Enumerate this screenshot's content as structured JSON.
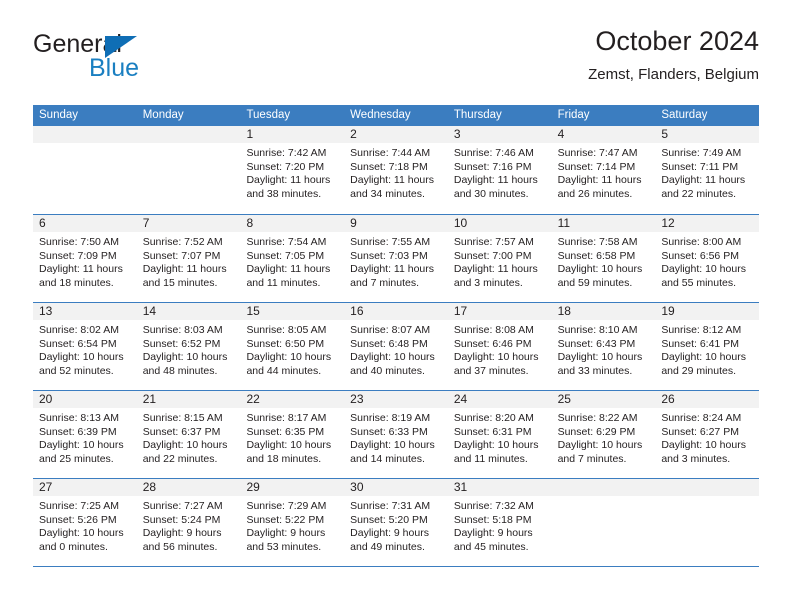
{
  "brand": {
    "name_part1": "General",
    "name_part2": "Blue",
    "logo_icon": "blue-triangle-icon",
    "color_primary": "#0f6eb5",
    "color_secondary": "#1a7fc1"
  },
  "header": {
    "title": "October 2024",
    "subtitle": "Zemst, Flanders, Belgium"
  },
  "theme": {
    "header_row_background": "#3b7dc0",
    "header_row_text": "#ffffff",
    "day_number_background": "#f2f2f2",
    "row_separator": "#3b7dc0",
    "body_text": "#231f20"
  },
  "weekdays": [
    "Sunday",
    "Monday",
    "Tuesday",
    "Wednesday",
    "Thursday",
    "Friday",
    "Saturday"
  ],
  "labels": {
    "sunrise_prefix": "Sunrise: ",
    "sunset_prefix": "Sunset: ",
    "daylight_prefix": "Daylight: "
  },
  "weeks": [
    [
      {
        "day": "",
        "sunrise": "",
        "sunset": "",
        "daylight_line1": "",
        "daylight_line2": "",
        "empty": true
      },
      {
        "day": "",
        "sunrise": "",
        "sunset": "",
        "daylight_line1": "",
        "daylight_line2": "",
        "empty": true
      },
      {
        "day": "1",
        "sunrise": "Sunrise: 7:42 AM",
        "sunset": "Sunset: 7:20 PM",
        "daylight_line1": "Daylight: 11 hours",
        "daylight_line2": "and 38 minutes."
      },
      {
        "day": "2",
        "sunrise": "Sunrise: 7:44 AM",
        "sunset": "Sunset: 7:18 PM",
        "daylight_line1": "Daylight: 11 hours",
        "daylight_line2": "and 34 minutes."
      },
      {
        "day": "3",
        "sunrise": "Sunrise: 7:46 AM",
        "sunset": "Sunset: 7:16 PM",
        "daylight_line1": "Daylight: 11 hours",
        "daylight_line2": "and 30 minutes."
      },
      {
        "day": "4",
        "sunrise": "Sunrise: 7:47 AM",
        "sunset": "Sunset: 7:14 PM",
        "daylight_line1": "Daylight: 11 hours",
        "daylight_line2": "and 26 minutes."
      },
      {
        "day": "5",
        "sunrise": "Sunrise: 7:49 AM",
        "sunset": "Sunset: 7:11 PM",
        "daylight_line1": "Daylight: 11 hours",
        "daylight_line2": "and 22 minutes."
      }
    ],
    [
      {
        "day": "6",
        "sunrise": "Sunrise: 7:50 AM",
        "sunset": "Sunset: 7:09 PM",
        "daylight_line1": "Daylight: 11 hours",
        "daylight_line2": "and 18 minutes."
      },
      {
        "day": "7",
        "sunrise": "Sunrise: 7:52 AM",
        "sunset": "Sunset: 7:07 PM",
        "daylight_line1": "Daylight: 11 hours",
        "daylight_line2": "and 15 minutes."
      },
      {
        "day": "8",
        "sunrise": "Sunrise: 7:54 AM",
        "sunset": "Sunset: 7:05 PM",
        "daylight_line1": "Daylight: 11 hours",
        "daylight_line2": "and 11 minutes."
      },
      {
        "day": "9",
        "sunrise": "Sunrise: 7:55 AM",
        "sunset": "Sunset: 7:03 PM",
        "daylight_line1": "Daylight: 11 hours",
        "daylight_line2": "and 7 minutes."
      },
      {
        "day": "10",
        "sunrise": "Sunrise: 7:57 AM",
        "sunset": "Sunset: 7:00 PM",
        "daylight_line1": "Daylight: 11 hours",
        "daylight_line2": "and 3 minutes."
      },
      {
        "day": "11",
        "sunrise": "Sunrise: 7:58 AM",
        "sunset": "Sunset: 6:58 PM",
        "daylight_line1": "Daylight: 10 hours",
        "daylight_line2": "and 59 minutes."
      },
      {
        "day": "12",
        "sunrise": "Sunrise: 8:00 AM",
        "sunset": "Sunset: 6:56 PM",
        "daylight_line1": "Daylight: 10 hours",
        "daylight_line2": "and 55 minutes."
      }
    ],
    [
      {
        "day": "13",
        "sunrise": "Sunrise: 8:02 AM",
        "sunset": "Sunset: 6:54 PM",
        "daylight_line1": "Daylight: 10 hours",
        "daylight_line2": "and 52 minutes."
      },
      {
        "day": "14",
        "sunrise": "Sunrise: 8:03 AM",
        "sunset": "Sunset: 6:52 PM",
        "daylight_line1": "Daylight: 10 hours",
        "daylight_line2": "and 48 minutes."
      },
      {
        "day": "15",
        "sunrise": "Sunrise: 8:05 AM",
        "sunset": "Sunset: 6:50 PM",
        "daylight_line1": "Daylight: 10 hours",
        "daylight_line2": "and 44 minutes."
      },
      {
        "day": "16",
        "sunrise": "Sunrise: 8:07 AM",
        "sunset": "Sunset: 6:48 PM",
        "daylight_line1": "Daylight: 10 hours",
        "daylight_line2": "and 40 minutes."
      },
      {
        "day": "17",
        "sunrise": "Sunrise: 8:08 AM",
        "sunset": "Sunset: 6:46 PM",
        "daylight_line1": "Daylight: 10 hours",
        "daylight_line2": "and 37 minutes."
      },
      {
        "day": "18",
        "sunrise": "Sunrise: 8:10 AM",
        "sunset": "Sunset: 6:43 PM",
        "daylight_line1": "Daylight: 10 hours",
        "daylight_line2": "and 33 minutes."
      },
      {
        "day": "19",
        "sunrise": "Sunrise: 8:12 AM",
        "sunset": "Sunset: 6:41 PM",
        "daylight_line1": "Daylight: 10 hours",
        "daylight_line2": "and 29 minutes."
      }
    ],
    [
      {
        "day": "20",
        "sunrise": "Sunrise: 8:13 AM",
        "sunset": "Sunset: 6:39 PM",
        "daylight_line1": "Daylight: 10 hours",
        "daylight_line2": "and 25 minutes."
      },
      {
        "day": "21",
        "sunrise": "Sunrise: 8:15 AM",
        "sunset": "Sunset: 6:37 PM",
        "daylight_line1": "Daylight: 10 hours",
        "daylight_line2": "and 22 minutes."
      },
      {
        "day": "22",
        "sunrise": "Sunrise: 8:17 AM",
        "sunset": "Sunset: 6:35 PM",
        "daylight_line1": "Daylight: 10 hours",
        "daylight_line2": "and 18 minutes."
      },
      {
        "day": "23",
        "sunrise": "Sunrise: 8:19 AM",
        "sunset": "Sunset: 6:33 PM",
        "daylight_line1": "Daylight: 10 hours",
        "daylight_line2": "and 14 minutes."
      },
      {
        "day": "24",
        "sunrise": "Sunrise: 8:20 AM",
        "sunset": "Sunset: 6:31 PM",
        "daylight_line1": "Daylight: 10 hours",
        "daylight_line2": "and 11 minutes."
      },
      {
        "day": "25",
        "sunrise": "Sunrise: 8:22 AM",
        "sunset": "Sunset: 6:29 PM",
        "daylight_line1": "Daylight: 10 hours",
        "daylight_line2": "and 7 minutes."
      },
      {
        "day": "26",
        "sunrise": "Sunrise: 8:24 AM",
        "sunset": "Sunset: 6:27 PM",
        "daylight_line1": "Daylight: 10 hours",
        "daylight_line2": "and 3 minutes."
      }
    ],
    [
      {
        "day": "27",
        "sunrise": "Sunrise: 7:25 AM",
        "sunset": "Sunset: 5:26 PM",
        "daylight_line1": "Daylight: 10 hours",
        "daylight_line2": "and 0 minutes."
      },
      {
        "day": "28",
        "sunrise": "Sunrise: 7:27 AM",
        "sunset": "Sunset: 5:24 PM",
        "daylight_line1": "Daylight: 9 hours",
        "daylight_line2": "and 56 minutes."
      },
      {
        "day": "29",
        "sunrise": "Sunrise: 7:29 AM",
        "sunset": "Sunset: 5:22 PM",
        "daylight_line1": "Daylight: 9 hours",
        "daylight_line2": "and 53 minutes."
      },
      {
        "day": "30",
        "sunrise": "Sunrise: 7:31 AM",
        "sunset": "Sunset: 5:20 PM",
        "daylight_line1": "Daylight: 9 hours",
        "daylight_line2": "and 49 minutes."
      },
      {
        "day": "31",
        "sunrise": "Sunrise: 7:32 AM",
        "sunset": "Sunset: 5:18 PM",
        "daylight_line1": "Daylight: 9 hours",
        "daylight_line2": "and 45 minutes."
      },
      {
        "day": "",
        "sunrise": "",
        "sunset": "",
        "daylight_line1": "",
        "daylight_line2": "",
        "empty": true
      },
      {
        "day": "",
        "sunrise": "",
        "sunset": "",
        "daylight_line1": "",
        "daylight_line2": "",
        "empty": true
      }
    ]
  ]
}
